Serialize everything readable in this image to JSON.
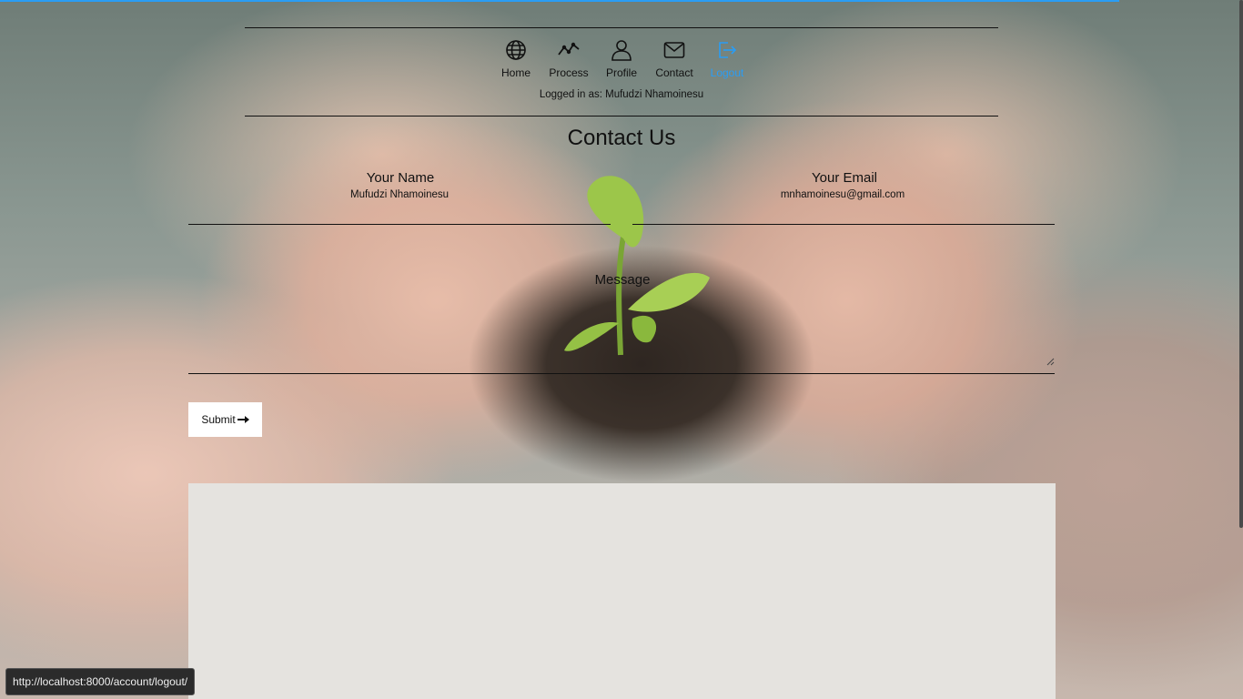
{
  "nav": {
    "items": [
      {
        "label": "Home",
        "icon": "globe-icon"
      },
      {
        "label": "Process",
        "icon": "trend-line-icon"
      },
      {
        "label": "Profile",
        "icon": "person-icon"
      },
      {
        "label": "Contact",
        "icon": "envelope-icon"
      },
      {
        "label": "Logout",
        "icon": "logout-icon",
        "active": true
      }
    ],
    "logged_in_text": "Logged in as: Mufudzi Nhamoinesu"
  },
  "page": {
    "title": "Contact Us"
  },
  "form": {
    "name_label": "Your Name",
    "name_value": "Mufudzi Nhamoinesu",
    "email_label": "Your Email",
    "email_value": "mnhamoinesu@gmail.com",
    "message_label": "Message",
    "message_value": "",
    "submit_label": "Submit",
    "submit_icon": "arrow-right-icon"
  },
  "status_bar": {
    "url": "http://localhost:8000/account/logout/"
  },
  "colors": {
    "accent": "#2a9df4",
    "map_panel": "#e5e3df"
  }
}
